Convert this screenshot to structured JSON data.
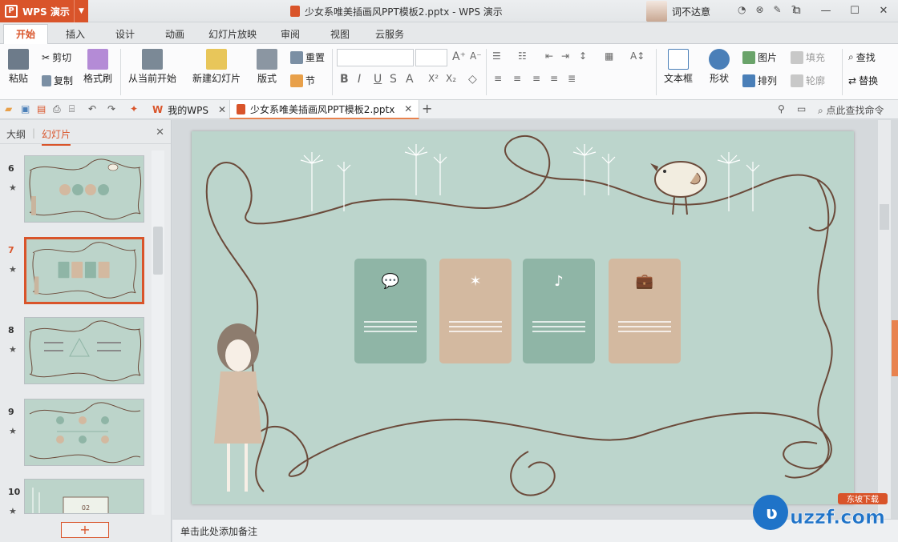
{
  "app": {
    "menu_button": "WPS 演示",
    "doc_title": "少女系唯美插画风PPT模板2.pptx - WPS 演示",
    "user_name": "词不达意"
  },
  "ribbon_tabs": [
    "开始",
    "插入",
    "设计",
    "动画",
    "幻灯片放映",
    "审阅",
    "视图",
    "云服务"
  ],
  "ribbon": {
    "paste": "粘贴",
    "cut": "剪切",
    "copy": "复制",
    "format_painter": "格式刷",
    "from_current": "从当前开始",
    "new_slide": "新建幻灯片",
    "layout": "版式",
    "reset": "重置",
    "section": "节",
    "textbox": "文本框",
    "shape": "形状",
    "picture": "图片",
    "fill": "填充",
    "arrange": "排列",
    "outline": "轮廓",
    "find": "查找",
    "replace": "替换"
  },
  "doc_tabs": {
    "my_wps": "我的WPS",
    "current": "少女系唯美插画风PPT模板2.pptx",
    "search": "点此查找命令"
  },
  "left_pane": {
    "outline_tab": "大纲",
    "slides_tab": "幻灯片",
    "slides": [
      {
        "num": "6"
      },
      {
        "num": "7"
      },
      {
        "num": "8"
      },
      {
        "num": "9"
      },
      {
        "num": "10"
      }
    ],
    "thumb_10_label": "02"
  },
  "notes_placeholder": "单击此处添加备注",
  "watermark": "uzzf.com",
  "watermark_cn": "东坡下载",
  "colors": {
    "accent": "#d9542a",
    "slide_bg": "#bcd5cc",
    "card_green": "#8fb5a6",
    "card_tan": "#d3b9a0"
  }
}
